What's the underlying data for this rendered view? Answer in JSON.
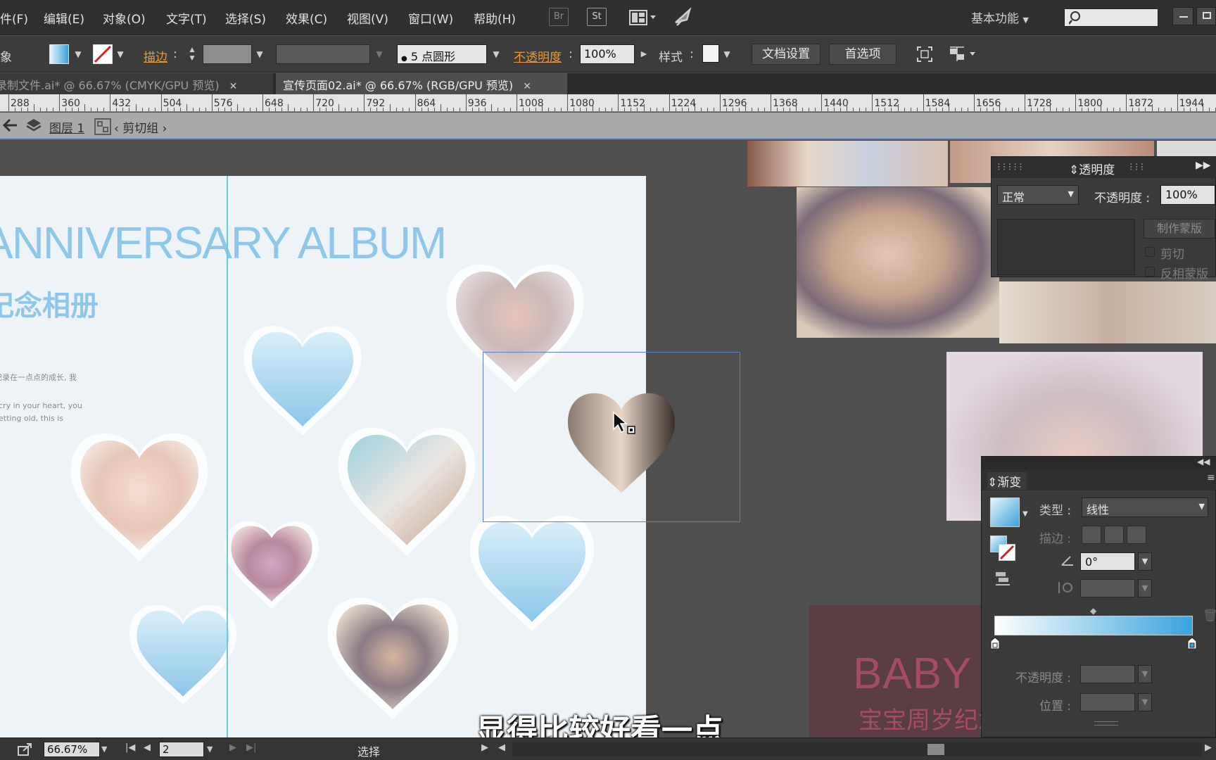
{
  "menubar": {
    "items": [
      "件(F)",
      "编辑(E)",
      "对象(O)",
      "文字(T)",
      "选择(S)",
      "效果(C)",
      "视图(V)",
      "窗口(W)",
      "帮助(H)"
    ],
    "bridge_label": "Br",
    "stock_label": "St",
    "workspace": "基本功能",
    "search_placeholder": ""
  },
  "controlbar": {
    "object_label": "象",
    "stroke_label": "描边",
    "brush_label": "5 点圆形",
    "opacity_label": "不透明度",
    "opacity_value": "100%",
    "style_label": "样式",
    "doc_setup_button": "文档设置",
    "preferences_button": "首选项"
  },
  "tabs": [
    {
      "label": "录制文件.ai* @ 66.67% (CMYK/GPU 预览)",
      "active": false
    },
    {
      "label": "宣传页面02.ai* @ 66.67% (RGB/GPU 预览)",
      "active": true
    }
  ],
  "ruler": {
    "labels": [
      "288",
      "360",
      "432",
      "504",
      "576",
      "648",
      "720",
      "792",
      "864",
      "936",
      "1008",
      "1080",
      "1152",
      "1224",
      "1296",
      "1368",
      "1440",
      "1512",
      "1584",
      "1656",
      "1728",
      "1800",
      "1872",
      "1944"
    ]
  },
  "breadcrumb": {
    "layer": "图层 1",
    "group": "剪切组"
  },
  "artboard": {
    "title_en": "ANNIVERSARY ALBUM",
    "title_cn": "纪念相册",
    "small_cn": "记录在一点点的成长, 我",
    "small_en_1": "cry in your heart, you",
    "small_en_2": "etting old, this is"
  },
  "background_art": {
    "baby_text": "BABY",
    "baby_cn": "宝宝周岁纪念相册"
  },
  "transparency_panel": {
    "title": "透明度",
    "blend_mode": "正常",
    "opacity_label": "不透明度",
    "opacity_value": "100%",
    "make_mask_button": "制作蒙版",
    "clip_label": "剪切",
    "invert_label": "反相蒙版"
  },
  "gradient_panel": {
    "title": "渐变",
    "type_label": "类型",
    "type_value": "线性",
    "stroke_label": "描边",
    "angle_value": "0°",
    "opacity_label": "不透明度",
    "position_label": "位置",
    "colors": {
      "start": "#ffffff",
      "end": "#3aa3dc"
    }
  },
  "statusbar": {
    "zoom": "66.67%",
    "page": "2",
    "tool": "选择"
  },
  "subtitle": "显得比较好看一点",
  "colors": {
    "menubar_bg": "#303030",
    "selection_blue": "#6f8fd8",
    "heart_blue": "#a8d3ee",
    "accent_orange": "#e89b3b"
  }
}
